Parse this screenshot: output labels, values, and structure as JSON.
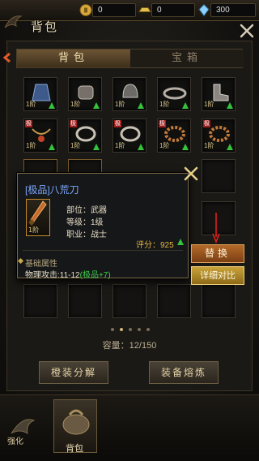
{
  "resources": [
    {
      "icon": "coin-icon",
      "value": "0"
    },
    {
      "icon": "ingot-icon",
      "value": "0"
    },
    {
      "icon": "gem-icon",
      "value": "300"
    }
  ],
  "panel_title": "背包",
  "tabs": [
    {
      "label": "背包",
      "active": true
    },
    {
      "label": "宝箱",
      "active": false
    }
  ],
  "grid": {
    "rows": [
      [
        {
          "name": "robe",
          "level": "1阶",
          "upgrade": true,
          "tag": ""
        },
        {
          "name": "gauntlet",
          "level": "1阶",
          "upgrade": true,
          "tag": ""
        },
        {
          "name": "helmet",
          "level": "1阶",
          "upgrade": true,
          "tag": ""
        },
        {
          "name": "belt",
          "level": "1阶",
          "upgrade": true,
          "tag": ""
        },
        {
          "name": "boots",
          "level": "1阶",
          "upgrade": true,
          "tag": ""
        }
      ],
      [
        {
          "name": "amulet",
          "level": "1阶",
          "upgrade": true,
          "tag": "极"
        },
        {
          "name": "ring",
          "level": "1阶",
          "upgrade": true,
          "tag": "极"
        },
        {
          "name": "ring",
          "level": "1阶",
          "upgrade": true,
          "tag": "极"
        },
        {
          "name": "bracelet",
          "level": "1阶",
          "upgrade": true,
          "tag": "极"
        },
        {
          "name": "bracelet",
          "level": "1阶",
          "upgrade": true,
          "tag": "极"
        }
      ]
    ]
  },
  "popup": {
    "item_name": "[极品]八荒刀",
    "item_level": "1阶",
    "attrs": [
      {
        "label": "部位：武器"
      },
      {
        "label": "等级：1级"
      },
      {
        "label": "职业：战士"
      }
    ],
    "score": "评分：925",
    "basic_attr_title": "基础属性",
    "phys_attack": "物理攻击:11-12",
    "phys_bonus": "(极品+7)"
  },
  "actions": {
    "replace": "替换",
    "compare": "详细对比"
  },
  "capacity": "容量：12/150",
  "bottom_buttons": {
    "decompose": "橙装分解",
    "smelt": "装备熔炼"
  },
  "nav": {
    "left_label": "强化",
    "bag_label": "背包"
  },
  "colors": {
    "accent_gold": "#c9a94a",
    "item_name_blue": "#7fa9ff",
    "upgrade_green": "#36c23a",
    "bonus_green": "#3fd24a"
  }
}
